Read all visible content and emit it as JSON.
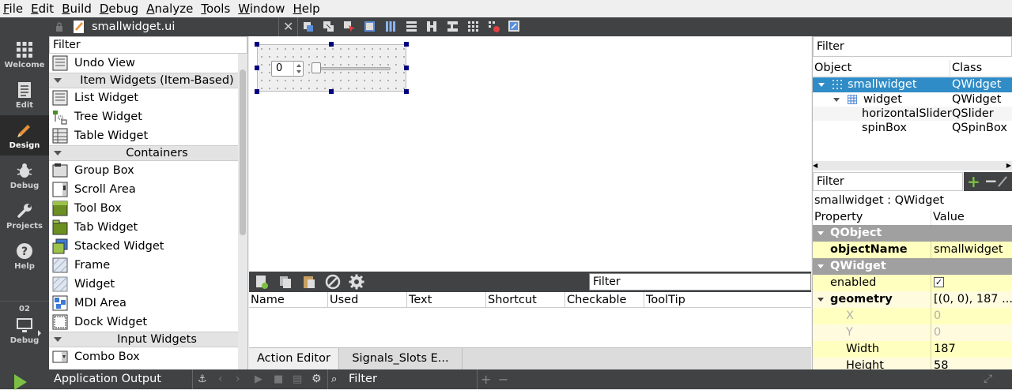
{
  "menu": [
    "File",
    "Edit",
    "Build",
    "Debug",
    "Analyze",
    "Tools",
    "Window",
    "Help"
  ],
  "modes": [
    {
      "label": "Welcome",
      "icon": "grid-icon"
    },
    {
      "label": "Edit",
      "icon": "document-icon"
    },
    {
      "label": "Design",
      "icon": "pencil-icon"
    },
    {
      "label": "Debug",
      "icon": "bug-icon"
    },
    {
      "label": "Projects",
      "icon": "wrench-icon"
    },
    {
      "label": "Help",
      "icon": "question-icon"
    }
  ],
  "kit": {
    "number": "02",
    "label": "Debug"
  },
  "document": {
    "filename": "smallwidget.ui"
  },
  "widgetbox": {
    "filter": "Filter",
    "undo_view": "Undo View",
    "cat_item_widgets": "Item Widgets (Item-Based)",
    "list_widget": "List Widget",
    "tree_widget": "Tree Widget",
    "table_widget": "Table Widget",
    "cat_containers": "Containers",
    "group_box": "Group Box",
    "scroll_area": "Scroll Area",
    "tool_box": "Tool Box",
    "tab_widget": "Tab Widget",
    "stacked_widget": "Stacked Widget",
    "frame": "Frame",
    "widget": "Widget",
    "mdi_area": "MDI Area",
    "dock_widget": "Dock Widget",
    "cat_input_widgets": "Input Widgets",
    "combo_box": "Combo Box"
  },
  "form": {
    "spin_value": "0",
    "slider_value": 0
  },
  "action_editor": {
    "filter": "Filter",
    "columns": [
      "Name",
      "Used",
      "Text",
      "Shortcut",
      "Checkable",
      "ToolTip"
    ],
    "tabs": [
      "Action Editor",
      "Signals_Slots E..."
    ]
  },
  "object_inspector": {
    "filter": "Filter",
    "col_object": "Object",
    "col_class": "Class",
    "rows": [
      {
        "object": "smallwidget",
        "class": "QWidget"
      },
      {
        "object": "widget",
        "class": "QWidget"
      },
      {
        "object": "horizontalSlider",
        "class": "QSlider"
      },
      {
        "object": "spinBox",
        "class": "QSpinBox"
      }
    ]
  },
  "property_editor": {
    "filter": "Filter",
    "context": "smallwidget : QWidget",
    "col_property": "Property",
    "col_value": "Value",
    "group_qobject": "QObject",
    "object_name_label": "objectName",
    "object_name_value": "smallwidget",
    "group_qwidget": "QWidget",
    "enabled_label": "enabled",
    "geometry_label": "geometry",
    "geometry_value": "[(0, 0), 187 ...",
    "x_label": "X",
    "x_value": "0",
    "y_label": "Y",
    "y_value": "0",
    "width_label": "Width",
    "width_value": "187",
    "height_label": "Height",
    "height_value": "58"
  },
  "bottom": {
    "pane_title": "Application Output",
    "filter": "Filter"
  },
  "colors": {
    "mode_bg": "#404244",
    "selection": "#308cc6",
    "prop_group": "#a0a0a0",
    "prop_yellow": "#ffffbf",
    "handle": "#000080",
    "run_green": "#7bc043"
  }
}
